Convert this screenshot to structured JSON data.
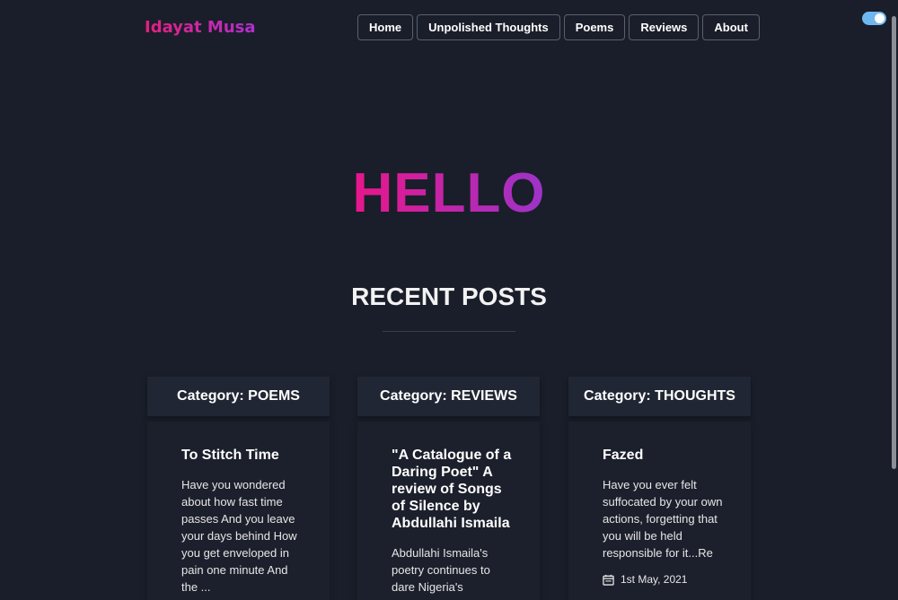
{
  "header": {
    "brand": "Idayat Musa",
    "nav": [
      "Home",
      "Unpolished Thoughts",
      "Poems",
      "Reviews",
      "About"
    ]
  },
  "hero": {
    "greeting": "HELLO"
  },
  "section": {
    "title": "RECENT POSTS"
  },
  "posts": [
    {
      "category": "Category: POEMS",
      "title": "To Stitch Time",
      "excerpt": "Have you wondered about how fast time passes And you leave your days behind How you get enveloped in pain one minute And the ..."
    },
    {
      "category": "Category: REVIEWS",
      "title": "\"A Catalogue of a Daring Poet\" A review of Songs of Silence by Abdullahi Ismaila",
      "excerpt": "Abdullahi Ismaila's poetry continues to dare Nigeria's"
    },
    {
      "category": "Category: THOUGHTS",
      "title": "Fazed",
      "excerpt": "Have you ever felt suffocated by your own actions, forgetting that you will be held responsible for it...Re",
      "date": "1st May, 2021",
      "date_icon": "calendar-icon"
    }
  ],
  "colors": {
    "background": "#1a1e2a",
    "brand_gradient_start": "#e3207c",
    "brand_gradient_end": "#b12fcf",
    "toggle": "#6fb8ef"
  }
}
